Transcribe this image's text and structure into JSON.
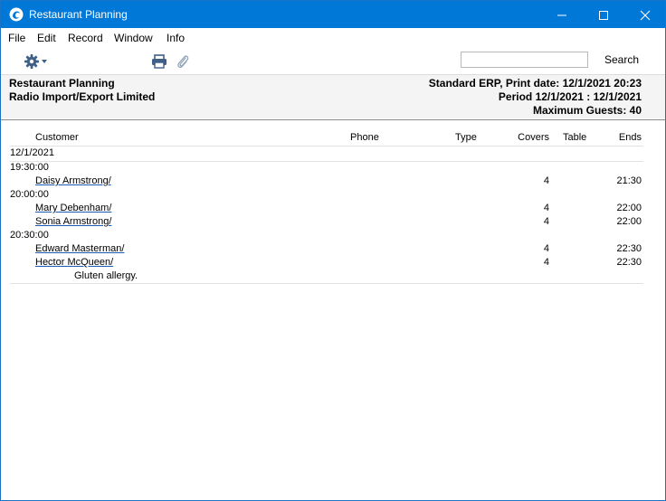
{
  "window": {
    "title": "Restaurant Planning"
  },
  "menu": [
    "File",
    "Edit",
    "Record",
    "Window",
    "Info"
  ],
  "toolbar": {
    "search_placeholder": "",
    "search_label": "Search"
  },
  "header": {
    "left": [
      "Restaurant Planning",
      "Radio Import/Export Limited"
    ],
    "right": [
      "Standard ERP, Print date: 12/1/2021 20:23",
      "Period  12/1/2021 : 12/1/2021",
      "Maximum Guests: 40"
    ]
  },
  "columns": {
    "customer": "Customer",
    "phone": "Phone",
    "type": "Type",
    "covers": "Covers",
    "table": "Table",
    "ends": "Ends"
  },
  "report": {
    "date": "12/1/2021",
    "slots": [
      {
        "time": "19:30:00",
        "rows": [
          {
            "customer": "Daisy Armstrong/",
            "covers": "4",
            "ends": "21:30"
          }
        ]
      },
      {
        "time": "20:00:00",
        "rows": [
          {
            "customer": "Mary Debenham/",
            "covers": "4",
            "ends": "22:00"
          },
          {
            "customer": "Sonia Armstrong/",
            "covers": "4",
            "ends": "22:00"
          }
        ]
      },
      {
        "time": "20:30:00",
        "rows": [
          {
            "customer": "Edward Masterman/",
            "covers": "4",
            "ends": "22:30"
          },
          {
            "customer": "Hector McQueen/",
            "covers": "4",
            "ends": "22:30"
          }
        ]
      }
    ],
    "note": "Gluten allergy."
  },
  "colors": {
    "titlebar": "#0078d7",
    "link_underline": "#1a5bb5",
    "header_bg": "#f4f4f4"
  },
  "icons": [
    "app-icon",
    "minimize-icon",
    "maximize-icon",
    "close-icon",
    "gear-icon",
    "printer-icon",
    "paperclip-icon"
  ]
}
